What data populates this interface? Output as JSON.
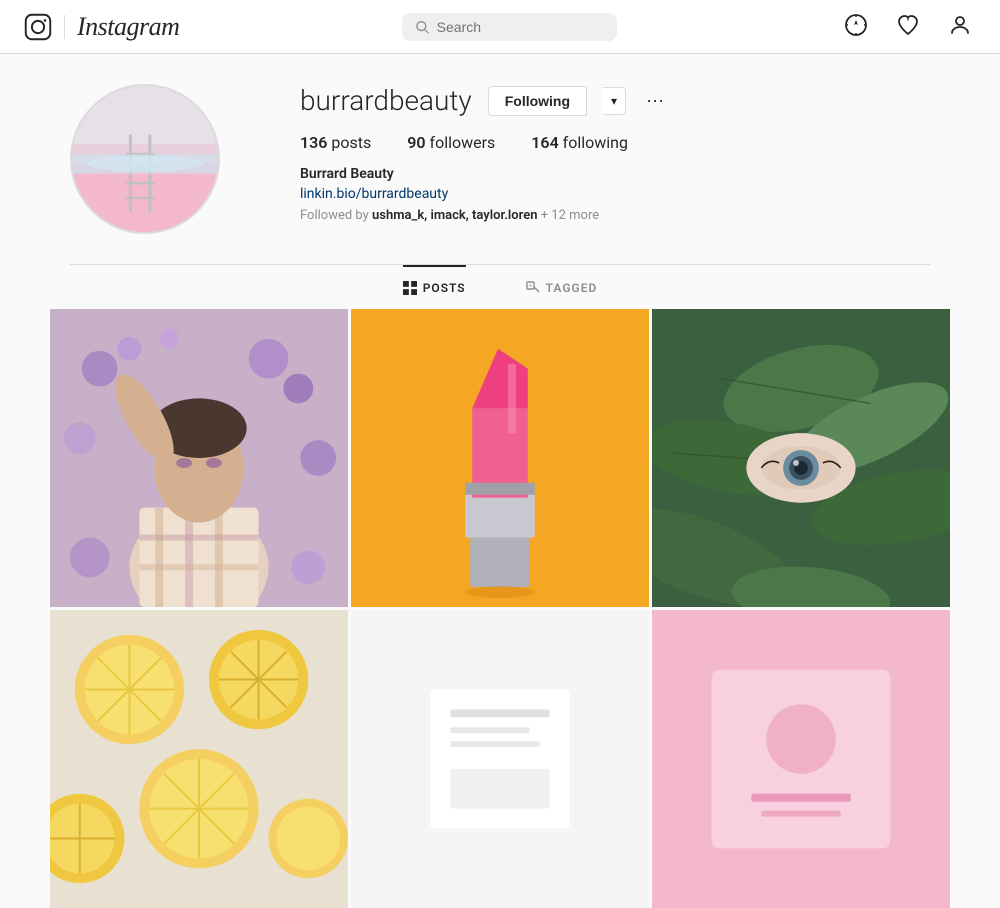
{
  "header": {
    "logo_text": "Instagram",
    "search_placeholder": "Search",
    "nav_icons": [
      "compass-icon",
      "heart-icon",
      "user-icon"
    ]
  },
  "profile": {
    "username": "burrardbeauty",
    "post_count": "136",
    "posts_label": "posts",
    "followers_count": "90",
    "followers_label": "followers",
    "following_count": "164",
    "following_label": "following",
    "fullname": "Burrard Beauty",
    "link": "linkin.bio/burrardbeauty",
    "followed_by_label": "Followed by",
    "followed_by_users": "ushma_k, imack, taylor.loren",
    "followed_by_more": "+ 12 more",
    "following_button_label": "Following",
    "dropdown_label": "▾",
    "more_options_label": "···"
  },
  "tabs": [
    {
      "id": "posts",
      "label": "POSTS",
      "icon": "grid-icon",
      "active": true
    },
    {
      "id": "tagged",
      "label": "TAGGED",
      "icon": "tag-icon",
      "active": false
    }
  ],
  "grid": {
    "images": [
      {
        "id": "img1",
        "type": "person",
        "alt": "Person with flowers"
      },
      {
        "id": "img2",
        "type": "lipstick",
        "alt": "Lipstick on orange background"
      },
      {
        "id": "img3",
        "type": "leaves",
        "alt": "Eye through leaves"
      },
      {
        "id": "img4",
        "type": "lemons",
        "alt": "Lemon slices"
      },
      {
        "id": "img5",
        "type": "white",
        "alt": "White background post"
      },
      {
        "id": "img6",
        "type": "pink",
        "alt": "Pink background post"
      }
    ]
  },
  "colors": {
    "accent_blue": "#003569",
    "border": "#dbdbdb",
    "text_light": "#8e8e8e"
  }
}
